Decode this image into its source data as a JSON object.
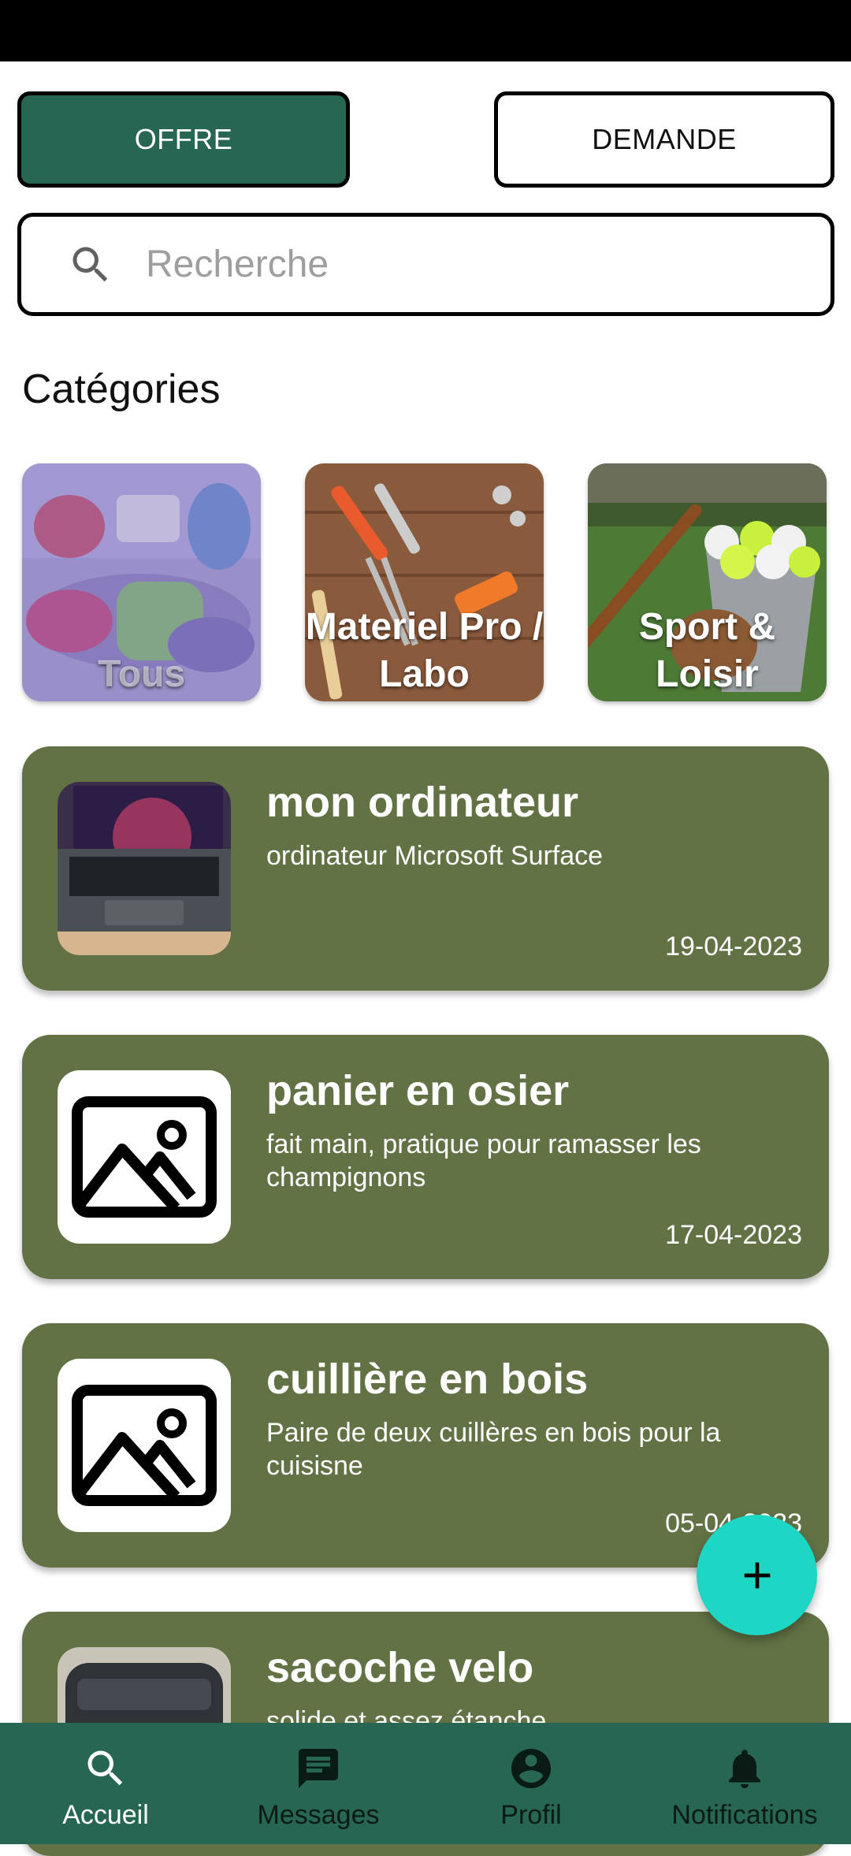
{
  "toggle": {
    "offre_label": "OFFRE",
    "demande_label": "DEMANDE",
    "active": "OFFRE"
  },
  "search": {
    "placeholder": "Recherche",
    "value": ""
  },
  "categories": {
    "title": "Catégories",
    "items": [
      {
        "label": "Tous"
      },
      {
        "label": "Materiel Pro / Labo"
      },
      {
        "label": "Sport & Loisir"
      }
    ]
  },
  "listings": [
    {
      "title": "mon ordinateur",
      "description": "ordinateur Microsoft Surface",
      "date": "19-04-2023"
    },
    {
      "title": "panier en osier",
      "description": "fait main, pratique pour ramasser les champignons",
      "date": "17-04-2023"
    },
    {
      "title": "cuillière en bois",
      "description": "Paire de deux cuillères en bois pour la cuisisne",
      "date": "05-04-2023"
    },
    {
      "title": "sacoche velo",
      "description": "solide et assez étanche",
      "date": ""
    }
  ],
  "fab": {
    "icon": "plus-icon"
  },
  "nav": {
    "items": [
      {
        "label": "Accueil",
        "icon": "search-icon",
        "active": true
      },
      {
        "label": "Messages",
        "icon": "message-icon"
      },
      {
        "label": "Profil",
        "icon": "account-circle-icon"
      },
      {
        "label": "Notifications",
        "icon": "bell-icon"
      }
    ]
  },
  "colors": {
    "primary": "#266652",
    "card": "#627245",
    "fab": "#1dd6c3"
  }
}
